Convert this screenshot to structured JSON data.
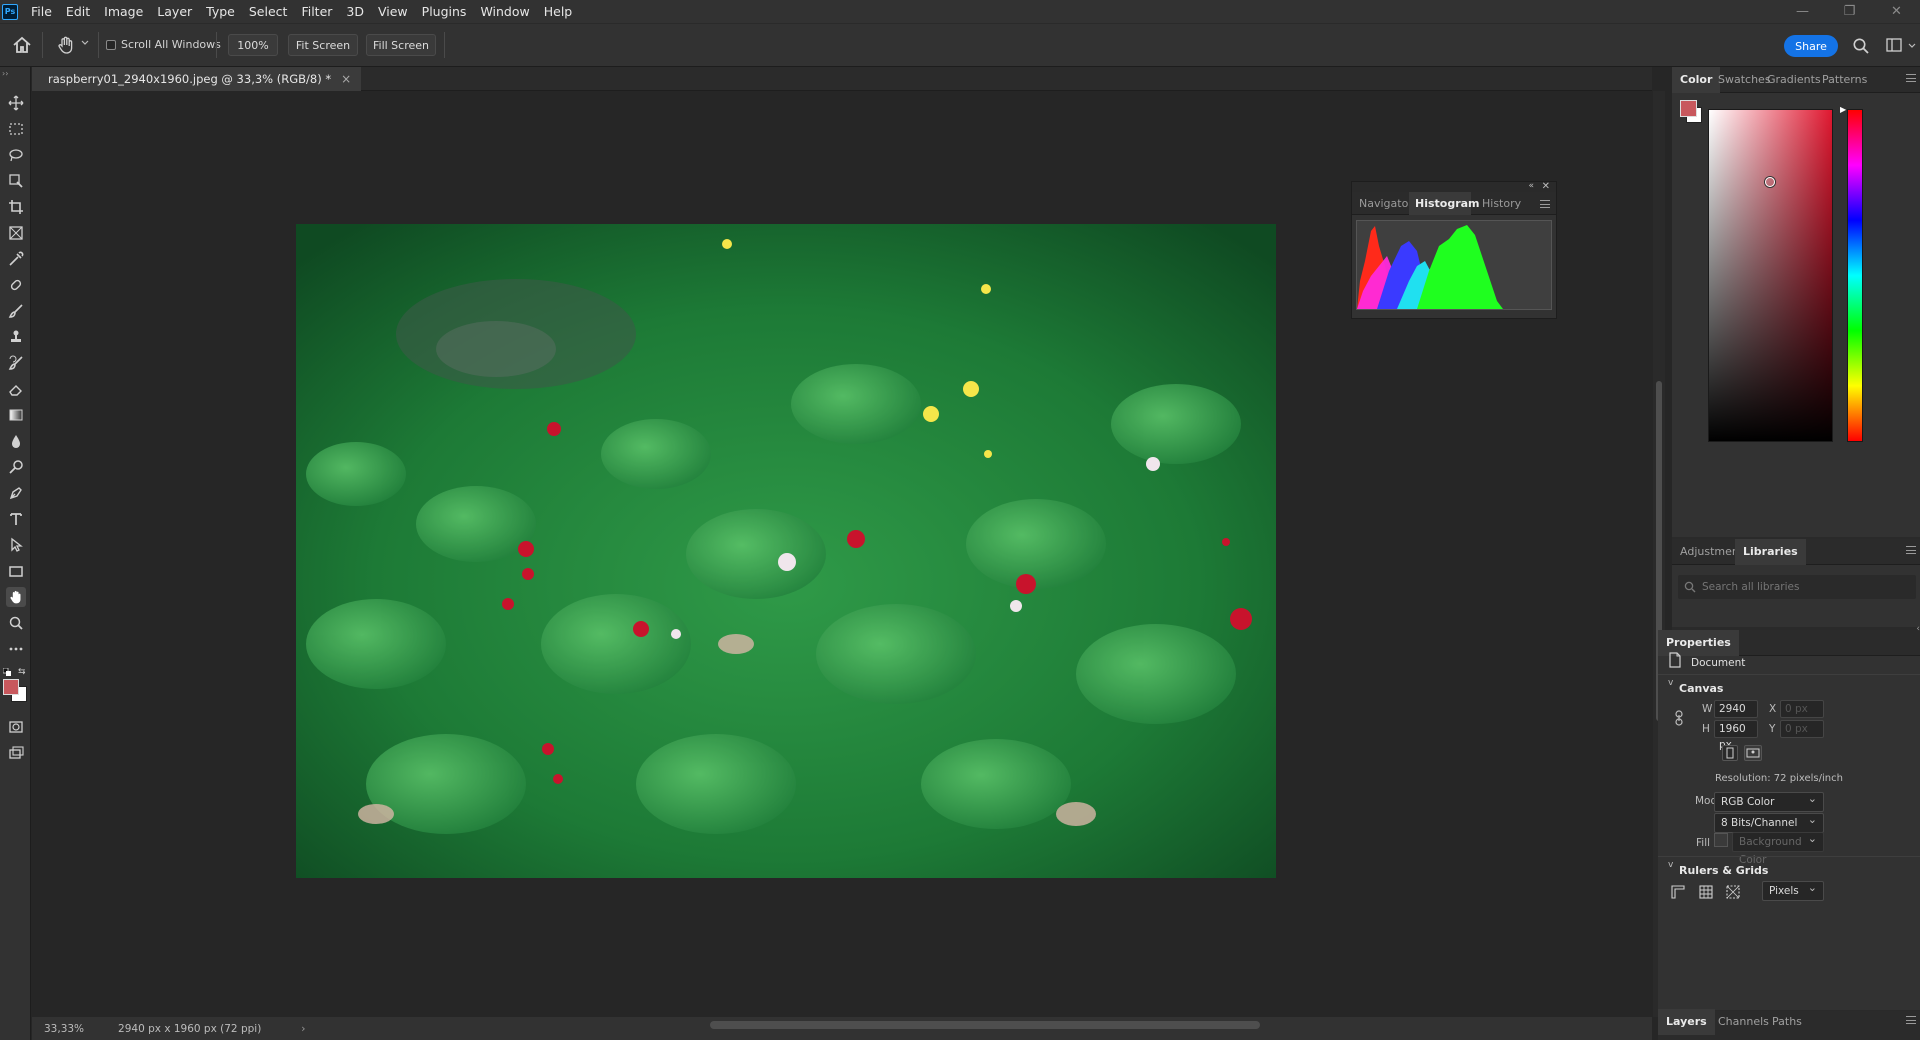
{
  "app": {
    "logo": "Ps"
  },
  "menu": [
    "File",
    "Edit",
    "Image",
    "Layer",
    "Type",
    "Select",
    "Filter",
    "3D",
    "View",
    "Plugins",
    "Window",
    "Help"
  ],
  "window_controls": {
    "minimize": "—",
    "restore": "❐",
    "close": "✕"
  },
  "options_bar": {
    "scroll_all_windows": "Scroll All Windows",
    "zoom_value": "100%",
    "fit_screen": "Fit Screen",
    "fill_screen": "Fill Screen",
    "share": "Share"
  },
  "document": {
    "tab_title": "raspberry01_2940x1960.jpeg @ 33,3% (RGB/8) *",
    "close": "×",
    "status_zoom": "33,33%",
    "status_info": "2940 px x 1960 px (72 ppi)",
    "status_arrow": "›"
  },
  "histogram_panel": {
    "tabs": [
      "Navigator",
      "Histogram",
      "History"
    ],
    "active_tab": "Histogram"
  },
  "color_panel": {
    "tabs": [
      "Color",
      "Swatches",
      "Gradients",
      "Patterns"
    ],
    "active_tab": "Color",
    "foreground_color": "#c8585d",
    "background_color": "#ffffff",
    "hue_color": "#e01830"
  },
  "libraries_panel": {
    "tabs": [
      "Adjustments",
      "Libraries"
    ],
    "active_tab": "Libraries",
    "search_placeholder": "Search all libraries"
  },
  "properties_panel": {
    "title": "Properties",
    "document_label": "Document",
    "canvas_section": "Canvas",
    "w_label": "W",
    "w_value": "2940 px",
    "h_label": "H",
    "h_value": "1960 px",
    "x_label": "X",
    "x_value": "0 px",
    "y_label": "Y",
    "y_value": "0 px",
    "resolution": "Resolution: 72 pixels/inch",
    "mode_label": "Mode",
    "mode_value": "RGB Color",
    "bits_value": "8 Bits/Channel",
    "fill_label": "Fill",
    "fill_value": "Background Color",
    "rulers_section": "Rulers & Grids",
    "units_value": "Pixels"
  },
  "layers_panel": {
    "tabs": [
      "Layers",
      "Channels",
      "Paths"
    ],
    "active_tab": "Layers"
  }
}
